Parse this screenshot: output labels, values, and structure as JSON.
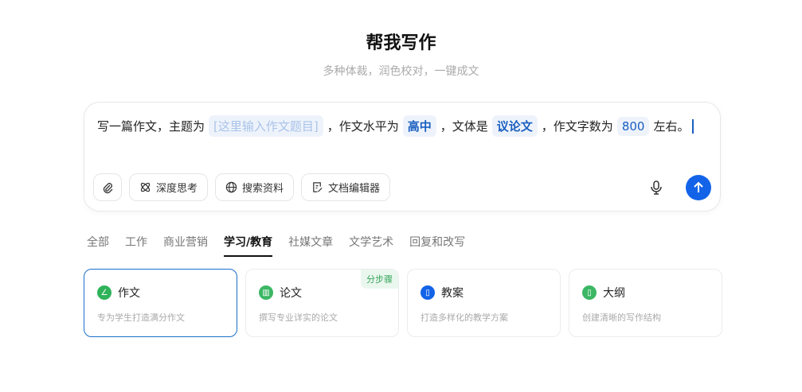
{
  "header": {
    "title": "帮我写作",
    "subtitle": "多种体裁，润色校对，一键成文"
  },
  "prompt": {
    "p1": "写一篇作文，主题为",
    "topic": "[这里输入作文题目]",
    "p2": "，作文水平为",
    "level": "高中",
    "p3": "，文体是",
    "genre": "议论文",
    "p4": "，作文字数为",
    "count": "800",
    "p5": "左右。"
  },
  "tools": {
    "deep": "深度思考",
    "search": "搜索资料",
    "editor": "文档编辑器"
  },
  "tabs": [
    "全部",
    "工作",
    "商业营销",
    "学习/教育",
    "社媒文章",
    "文学艺术",
    "回复和改写"
  ],
  "cards": [
    {
      "title": "作文",
      "desc": "专为学生打造满分作文",
      "color": "#2fb35a"
    },
    {
      "title": "论文",
      "desc": "撰写专业详实的论文",
      "badge": "分步骤",
      "color": "#3cb764"
    },
    {
      "title": "教案",
      "desc": "打造多样化的教学方案",
      "color": "#1363e8"
    },
    {
      "title": "大纲",
      "desc": "创建清晰的写作结构",
      "color": "#3cb764"
    }
  ]
}
